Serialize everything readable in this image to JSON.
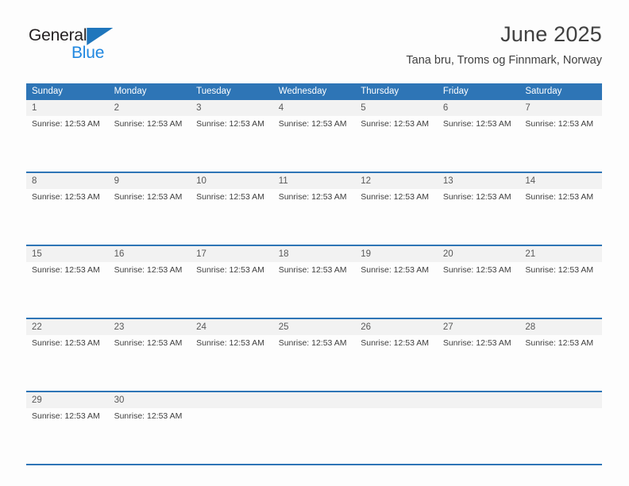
{
  "logo": {
    "word1": "General",
    "word2": "Blue",
    "triangle_icon": "triangle-icon",
    "color_dark": "#231f20",
    "color_blue": "#1f87e0",
    "triangle_color": "#1f76bc"
  },
  "header": {
    "title": "June 2025",
    "subtitle": "Tana bru, Troms og Finnmark, Norway"
  },
  "colors": {
    "header_blue": "#2e75b6",
    "daynum_band": "#f2f2f2",
    "page_background": "#fdfdfd",
    "text": "#404040"
  },
  "calendar": {
    "weekday_headers": [
      "Sunday",
      "Monday",
      "Tuesday",
      "Wednesday",
      "Thursday",
      "Friday",
      "Saturday"
    ],
    "weeks": [
      [
        {
          "day": "1",
          "events": [
            "Sunrise: 12:53 AM"
          ]
        },
        {
          "day": "2",
          "events": [
            "Sunrise: 12:53 AM"
          ]
        },
        {
          "day": "3",
          "events": [
            "Sunrise: 12:53 AM"
          ]
        },
        {
          "day": "4",
          "events": [
            "Sunrise: 12:53 AM"
          ]
        },
        {
          "day": "5",
          "events": [
            "Sunrise: 12:53 AM"
          ]
        },
        {
          "day": "6",
          "events": [
            "Sunrise: 12:53 AM"
          ]
        },
        {
          "day": "7",
          "events": [
            "Sunrise: 12:53 AM"
          ]
        }
      ],
      [
        {
          "day": "8",
          "events": [
            "Sunrise: 12:53 AM"
          ]
        },
        {
          "day": "9",
          "events": [
            "Sunrise: 12:53 AM"
          ]
        },
        {
          "day": "10",
          "events": [
            "Sunrise: 12:53 AM"
          ]
        },
        {
          "day": "11",
          "events": [
            "Sunrise: 12:53 AM"
          ]
        },
        {
          "day": "12",
          "events": [
            "Sunrise: 12:53 AM"
          ]
        },
        {
          "day": "13",
          "events": [
            "Sunrise: 12:53 AM"
          ]
        },
        {
          "day": "14",
          "events": [
            "Sunrise: 12:53 AM"
          ]
        }
      ],
      [
        {
          "day": "15",
          "events": [
            "Sunrise: 12:53 AM"
          ]
        },
        {
          "day": "16",
          "events": [
            "Sunrise: 12:53 AM"
          ]
        },
        {
          "day": "17",
          "events": [
            "Sunrise: 12:53 AM"
          ]
        },
        {
          "day": "18",
          "events": [
            "Sunrise: 12:53 AM"
          ]
        },
        {
          "day": "19",
          "events": [
            "Sunrise: 12:53 AM"
          ]
        },
        {
          "day": "20",
          "events": [
            "Sunrise: 12:53 AM"
          ]
        },
        {
          "day": "21",
          "events": [
            "Sunrise: 12:53 AM"
          ]
        }
      ],
      [
        {
          "day": "22",
          "events": [
            "Sunrise: 12:53 AM"
          ]
        },
        {
          "day": "23",
          "events": [
            "Sunrise: 12:53 AM"
          ]
        },
        {
          "day": "24",
          "events": [
            "Sunrise: 12:53 AM"
          ]
        },
        {
          "day": "25",
          "events": [
            "Sunrise: 12:53 AM"
          ]
        },
        {
          "day": "26",
          "events": [
            "Sunrise: 12:53 AM"
          ]
        },
        {
          "day": "27",
          "events": [
            "Sunrise: 12:53 AM"
          ]
        },
        {
          "day": "28",
          "events": [
            "Sunrise: 12:53 AM"
          ]
        }
      ],
      [
        {
          "day": "29",
          "events": [
            "Sunrise: 12:53 AM"
          ]
        },
        {
          "day": "30",
          "events": [
            "Sunrise: 12:53 AM"
          ]
        },
        {
          "day": "",
          "events": []
        },
        {
          "day": "",
          "events": []
        },
        {
          "day": "",
          "events": []
        },
        {
          "day": "",
          "events": []
        },
        {
          "day": "",
          "events": []
        }
      ]
    ]
  }
}
